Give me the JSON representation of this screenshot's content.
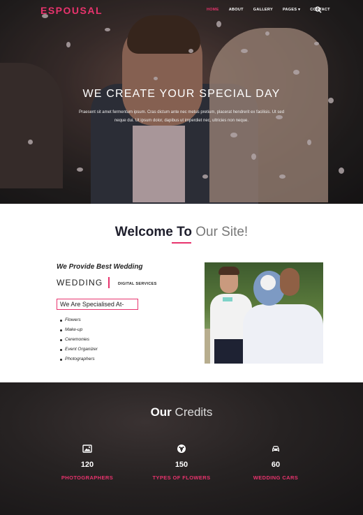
{
  "brand": {
    "logo": "ESPOUSAL",
    "accent_color": "#e8336d"
  },
  "nav": {
    "items": [
      {
        "label": "HOME",
        "active": true
      },
      {
        "label": "ABOUT",
        "active": false
      },
      {
        "label": "GALLERY",
        "active": false
      },
      {
        "label": "PAGES ▾",
        "active": false
      },
      {
        "label": "CONTACT",
        "active": false
      }
    ],
    "search_icon": "search-icon"
  },
  "hero": {
    "title": "WE CREATE YOUR SPECIAL DAY",
    "subtitle": "Praesent sit amet fermentum ipsum. Cras dictum ante nec metus pretium, placerat hendrerit ex facilisis. Ut sed neque dui. Ut ipsum dolor, dapibus ut imperdiet nec, ultricies non neque."
  },
  "welcome": {
    "title_strong": "Welcome To",
    "title_light": "Our Site!",
    "provide": "We Provide Best Wedding",
    "wedding": "WEDDING",
    "digital": "DIGITAL SERVICES",
    "specialised": "We Are Specialised At-",
    "services": [
      "Flowers",
      "Make-up",
      "Ceremonies",
      "Event Organizer",
      "Photographers"
    ]
  },
  "credits": {
    "title_strong": "Our",
    "title_light": "Credits",
    "items": [
      {
        "icon": "image-icon",
        "value": "120",
        "label": "PHOTOGRAPHERS"
      },
      {
        "icon": "flower-icon",
        "value": "150",
        "label": "TYPES OF FLOWERS"
      },
      {
        "icon": "car-icon",
        "value": "60",
        "label": "WEDDING CARS"
      }
    ]
  }
}
